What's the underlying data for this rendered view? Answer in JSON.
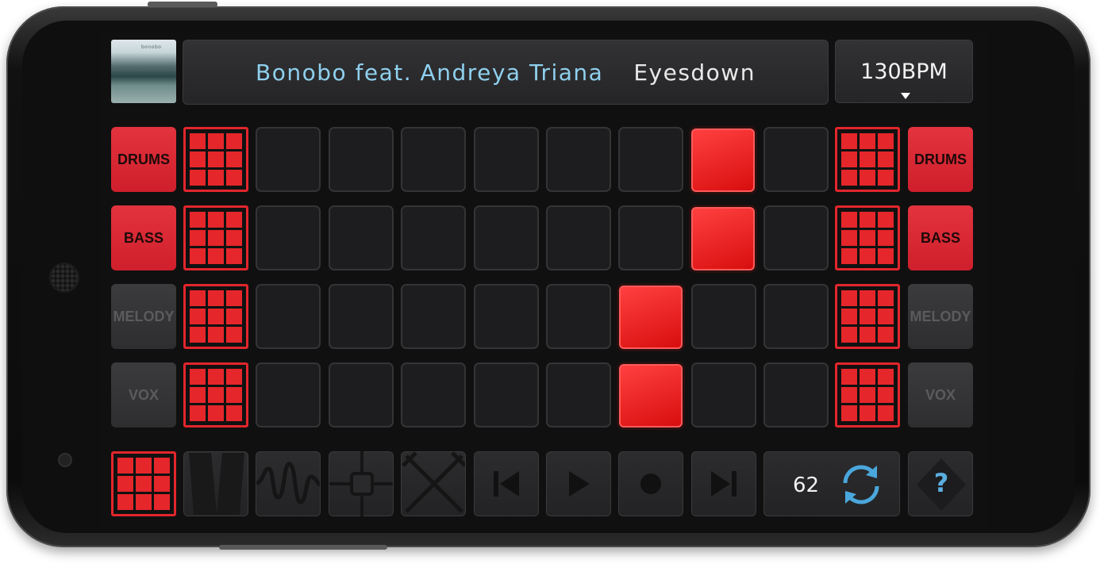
{
  "now_playing": {
    "artist": "Bonobo feat. Andreya Triana",
    "track": "Eyesdown"
  },
  "album_art": {
    "caption": "bonobo"
  },
  "tempo": {
    "label": "130BPM"
  },
  "left_labels": [
    {
      "label": "DRUMS",
      "active": true
    },
    {
      "label": "BASS",
      "active": true
    },
    {
      "label": "MELODY",
      "active": false
    },
    {
      "label": "VOX",
      "active": false
    }
  ],
  "right_labels": [
    {
      "label": "DRUMS",
      "active": true
    },
    {
      "label": "BASS",
      "active": true
    },
    {
      "label": "MELODY",
      "active": false
    },
    {
      "label": "VOX",
      "active": false
    }
  ],
  "pad_grid": {
    "rows": 4,
    "columns": 8,
    "active_column_per_row": [
      7,
      7,
      6,
      6
    ]
  },
  "loop_counter": "62",
  "help_label": "?",
  "toolbar_icons": [
    "pad-grid-icon",
    "filter-icon",
    "waveform-icon",
    "crossfader-icon",
    "stop-icon",
    "skip-back-icon",
    "play-icon",
    "record-icon",
    "skip-forward-icon",
    "loop-icon",
    "help-icon"
  ],
  "colors": {
    "accent": "#e5262a",
    "artist_text": "#8fd0ee",
    "loop_icon": "#4aa7dc"
  }
}
